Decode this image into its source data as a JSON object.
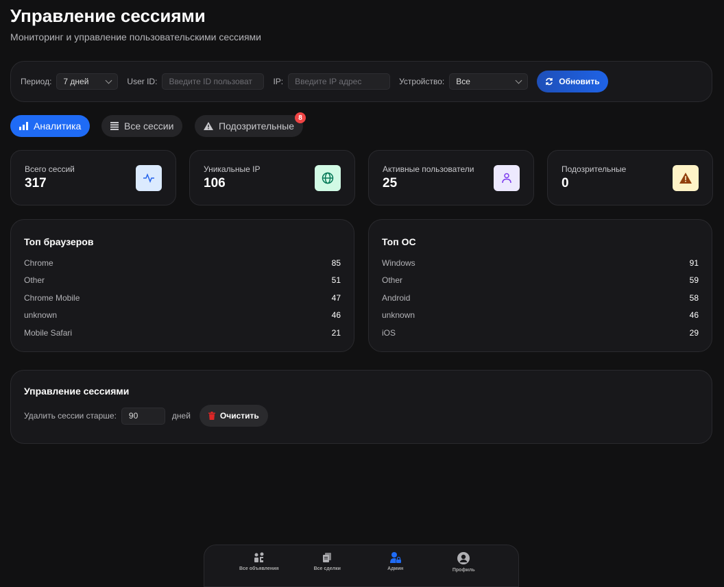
{
  "header": {
    "title": "Управление сессиями",
    "subtitle": "Мониторинг и управление пользовательскими сессиями"
  },
  "filters": {
    "period_label": "Период:",
    "period_value": "7 дней",
    "user_label": "User ID:",
    "user_placeholder": "Введите ID пользоват",
    "ip_label": "IP:",
    "ip_placeholder": "Введите IP адрес",
    "device_label": "Устройство:",
    "device_value": "Все",
    "refresh_label": "Обновить"
  },
  "tabs": [
    {
      "label": "Аналитика",
      "active": true,
      "icon": "bar-chart-icon"
    },
    {
      "label": "Все сессии",
      "icon": "list-icon"
    },
    {
      "label": "Подозрительные",
      "icon": "warning-icon",
      "badge": "8"
    }
  ],
  "stats": [
    {
      "label": "Всего сессий",
      "value": "317",
      "icon": "activity-icon",
      "color": "#2563eb",
      "bg": "#dbeafe"
    },
    {
      "label": "Уникальные IP",
      "value": "106",
      "icon": "globe-icon",
      "color": "#047857",
      "bg": "#d1fae5"
    },
    {
      "label": "Активные пользователи",
      "value": "25",
      "icon": "user-icon",
      "color": "#7c3aed",
      "bg": "#ede9fe"
    },
    {
      "label": "Подозрительные",
      "value": "0",
      "icon": "warning-icon",
      "color": "#92400e",
      "bg": "#fef3c7"
    }
  ],
  "browsers": {
    "title": "Топ браузеров",
    "items": [
      {
        "name": "Chrome",
        "value": "85"
      },
      {
        "name": "Other",
        "value": "51"
      },
      {
        "name": "Chrome Mobile",
        "value": "47"
      },
      {
        "name": "unknown",
        "value": "46"
      },
      {
        "name": "Mobile Safari",
        "value": "21"
      }
    ]
  },
  "os": {
    "title": "Топ ОС",
    "items": [
      {
        "name": "Windows",
        "value": "91"
      },
      {
        "name": "Other",
        "value": "59"
      },
      {
        "name": "Android",
        "value": "58"
      },
      {
        "name": "unknown",
        "value": "46"
      },
      {
        "name": "iOS",
        "value": "29"
      }
    ]
  },
  "management": {
    "title": "Управление сессиями",
    "delete_label": "Удалить сессии старше:",
    "days_value": "90",
    "days_unit": "дней",
    "clear_label": "Очистить"
  },
  "nav": [
    {
      "label": "Все объявления",
      "icon": "listings-icon"
    },
    {
      "label": "Все сделки",
      "icon": "deals-icon"
    },
    {
      "label": "Админ",
      "icon": "admin-icon",
      "active": true
    },
    {
      "label": "Профиль",
      "icon": "profile-icon"
    }
  ],
  "colors": {
    "accent": "#1f6bf5",
    "badge": "#ef4444",
    "danger": "#dc2626"
  }
}
